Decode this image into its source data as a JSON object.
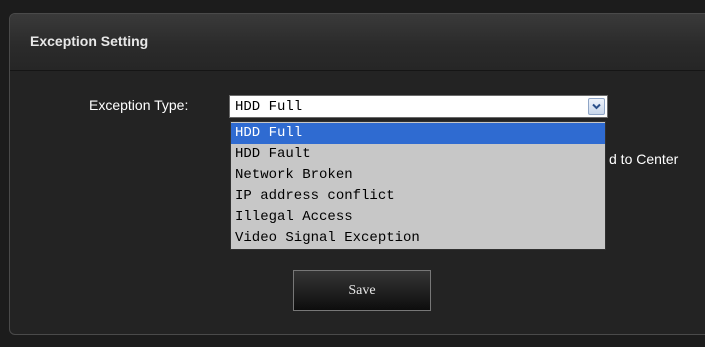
{
  "panel": {
    "title": "Exception Setting"
  },
  "form": {
    "exception_type_label": "Exception Type:",
    "exception_type_value": "HDD Full",
    "partial_checkbox_label": "d to Center",
    "save_label": "Save"
  },
  "dropdown": {
    "options": [
      "HDD Full",
      "HDD Fault",
      "Network Broken",
      "IP address conflict",
      "Illegal Access",
      "Video Signal Exception"
    ],
    "selected_index": 0
  },
  "colors": {
    "background": "#1c1c1c",
    "panel": "#232323",
    "highlight": "#2f6bd1",
    "dropdown_bg": "#c7c7c7"
  }
}
